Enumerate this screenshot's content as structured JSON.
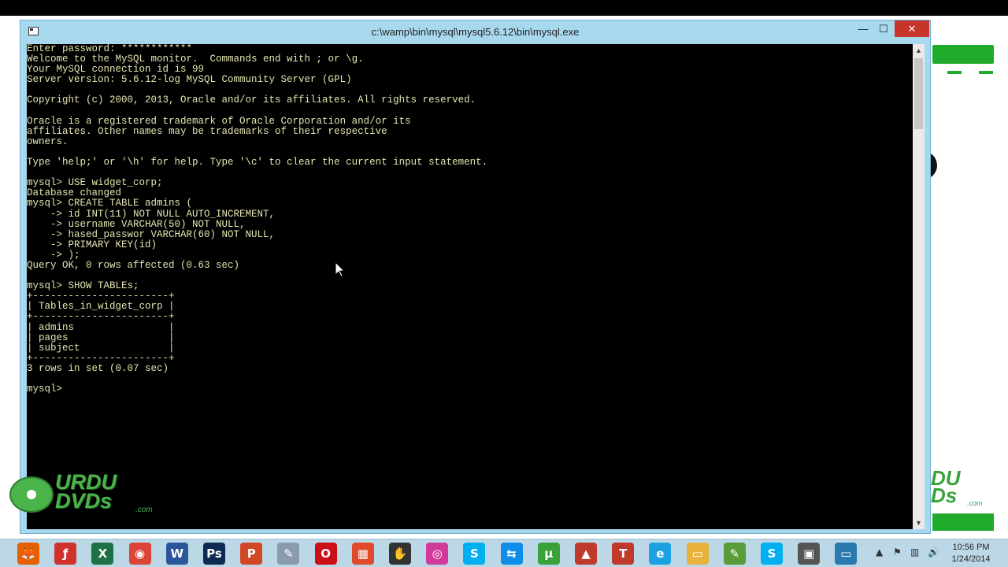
{
  "window": {
    "title": "c:\\wamp\\bin\\mysql\\mysql5.6.12\\bin\\mysql.exe",
    "min": "—",
    "max": "☐",
    "close": "✕"
  },
  "console": {
    "text": "Enter password: ************\nWelcome to the MySQL monitor.  Commands end with ; or \\g.\nYour MySQL connection id is 99\nServer version: 5.6.12-log MySQL Community Server (GPL)\n\nCopyright (c) 2000, 2013, Oracle and/or its affiliates. All rights reserved.\n\nOracle is a registered trademark of Oracle Corporation and/or its\naffiliates. Other names may be trademarks of their respective\nowners.\n\nType 'help;' or '\\h' for help. Type '\\c' to clear the current input statement.\n\nmysql> USE widget_corp;\nDatabase changed\nmysql> CREATE TABLE admins (\n    -> id INT(11) NOT NULL AUTO_INCREMENT,\n    -> username VARCHAR(50) NOT NULL,\n    -> hased_passwor VARCHAR(60) NOT NULL,\n    -> PRIMARY KEY(id)\n    -> );\nQuery OK, 0 rows affected (0.63 sec)\n\nmysql> SHOW TABLEs;\n+-----------------------+\n| Tables_in_widget_corp |\n+-----------------------+\n| admins                |\n| pages                 |\n| subject               |\n+-----------------------+\n3 rows in set (0.07 sec)\n\nmysql> "
  },
  "watermark": {
    "line1": "URDU",
    "line2": "DVDs",
    "suffix": ".com"
  },
  "bg_app": {
    "logo_text": "DU\nDs",
    "logo_suffix": ".com"
  },
  "taskbar": {
    "icons": [
      {
        "name": "firefox-icon",
        "glyph": "🦊",
        "color": "#e66000"
      },
      {
        "name": "flash-icon",
        "glyph": "ƒ",
        "color": "#d0312d"
      },
      {
        "name": "excel-icon",
        "glyph": "X",
        "color": "#1e7145"
      },
      {
        "name": "chrome-icon",
        "glyph": "◉",
        "color": "#db4437"
      },
      {
        "name": "word-icon",
        "glyph": "W",
        "color": "#2b579a"
      },
      {
        "name": "photoshop-icon",
        "glyph": "Ps",
        "color": "#0c2a52"
      },
      {
        "name": "powerpoint-icon",
        "glyph": "P",
        "color": "#d24726"
      },
      {
        "name": "paint-icon",
        "glyph": "✎",
        "color": "#8a9bb0"
      },
      {
        "name": "opera-icon",
        "glyph": "O",
        "color": "#cc0f16"
      },
      {
        "name": "tiles-icon",
        "glyph": "▦",
        "color": "#e04a2b"
      },
      {
        "name": "hand-app-icon",
        "glyph": "✋",
        "color": "#333333"
      },
      {
        "name": "pink-app-icon",
        "glyph": "◎",
        "color": "#d23a9a"
      },
      {
        "name": "skype-icon",
        "glyph": "S",
        "color": "#00aff0"
      },
      {
        "name": "teamviewer-icon",
        "glyph": "⇆",
        "color": "#0e8ee9"
      },
      {
        "name": "utorrent-icon",
        "glyph": "μ",
        "color": "#3aa13a"
      },
      {
        "name": "pro-app-icon",
        "glyph": "▲",
        "color": "#c03a2b"
      },
      {
        "name": "tally-icon",
        "glyph": "T",
        "color": "#c0392b"
      },
      {
        "name": "ie-icon",
        "glyph": "e",
        "color": "#1ba1e2"
      },
      {
        "name": "folder-icon",
        "glyph": "▭",
        "color": "#e8b13c"
      },
      {
        "name": "notepad-icon",
        "glyph": "✎",
        "color": "#5a9b3a"
      },
      {
        "name": "skype2-icon",
        "glyph": "S",
        "color": "#00aff0"
      },
      {
        "name": "camera-app-icon",
        "glyph": "▣",
        "color": "#555555"
      },
      {
        "name": "console-app-icon",
        "glyph": "▭",
        "color": "#2a7ab0"
      }
    ],
    "tray": {
      "arrow": "▲",
      "flag": "⚑",
      "network": "▥",
      "volume": "🔊"
    },
    "time": "10:56 PM",
    "date": "1/24/2014"
  }
}
